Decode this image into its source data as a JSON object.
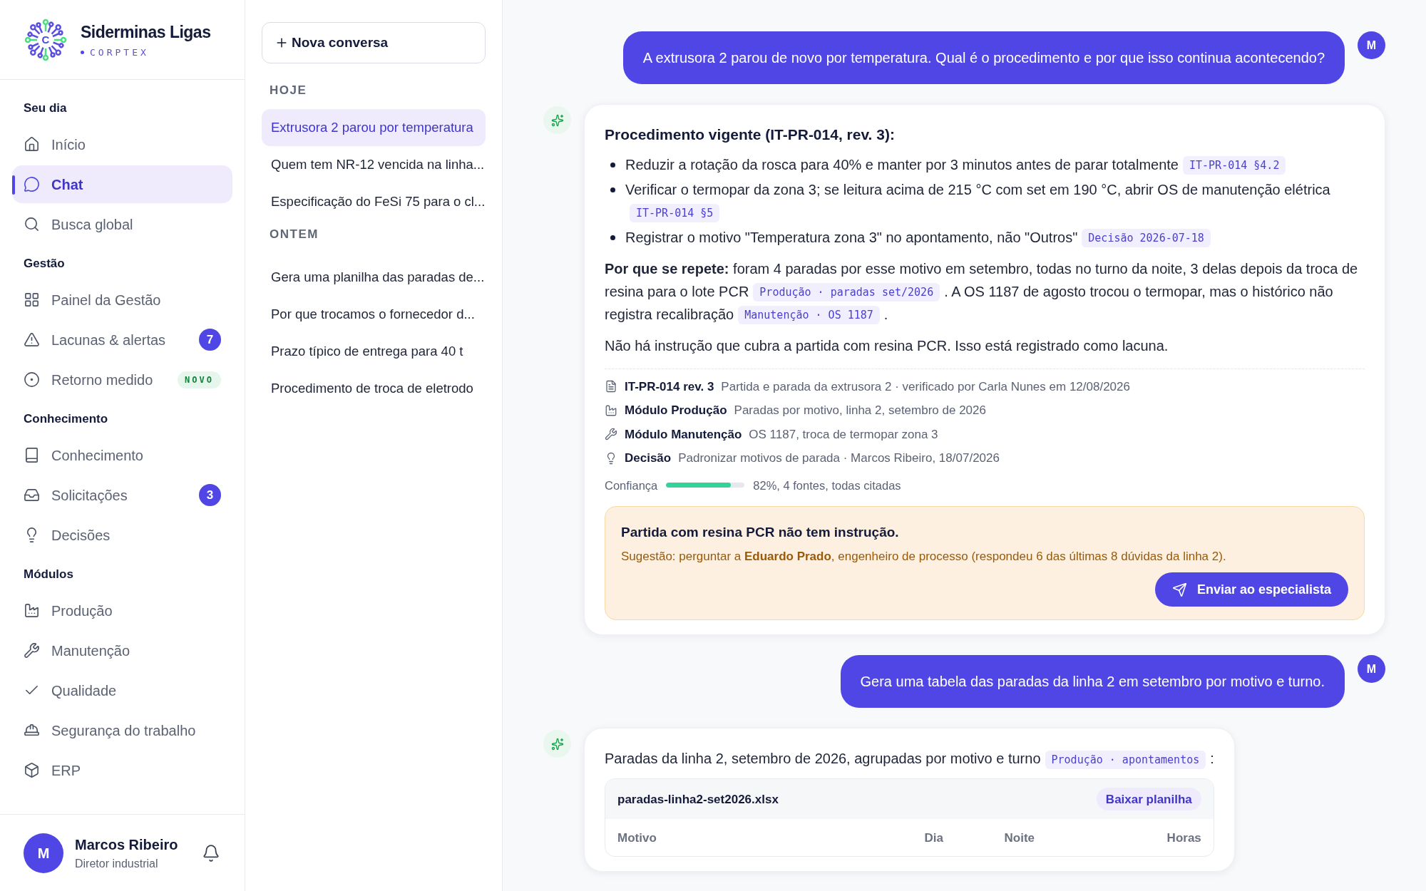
{
  "brand": {
    "name": "Siderminas Ligas",
    "product": "CORPTEX",
    "logo_letter": "C"
  },
  "sidebar": {
    "sections": [
      {
        "title": "Seu dia",
        "items": [
          {
            "label": "Início",
            "selected": false
          },
          {
            "label": "Chat",
            "selected": true
          },
          {
            "label": "Busca global",
            "selected": false
          }
        ]
      },
      {
        "title": "Gestão",
        "items": [
          {
            "label": "Painel da Gestão",
            "selected": false
          },
          {
            "label": "Lacunas & alertas",
            "selected": false,
            "badge": {
              "kind": "count",
              "text": "7"
            }
          },
          {
            "label": "Retorno medido",
            "selected": false,
            "badge": {
              "kind": "new",
              "text": "NOVO"
            }
          }
        ]
      },
      {
        "title": "Conhecimento",
        "items": [
          {
            "label": "Conhecimento",
            "selected": false
          },
          {
            "label": "Solicitações",
            "selected": false,
            "badge": {
              "kind": "count",
              "text": "3"
            }
          },
          {
            "label": "Decisões",
            "selected": false
          }
        ]
      },
      {
        "title": "Módulos",
        "items": [
          {
            "label": "Produção",
            "selected": false
          },
          {
            "label": "Manutenção",
            "selected": false
          },
          {
            "label": "Qualidade",
            "selected": false
          },
          {
            "label": "Segurança do trabalho",
            "selected": false
          },
          {
            "label": "ERP",
            "selected": false
          }
        ]
      }
    ],
    "user": {
      "initial": "M",
      "name": "Marcos Ribeiro",
      "role": "Diretor industrial"
    }
  },
  "conversations": {
    "new_button": "Nova conversa",
    "groups": [
      {
        "title": "HOJE",
        "items": [
          {
            "title": "Extrusora 2 parou por temperatura",
            "selected": true
          },
          {
            "title": "Quem tem NR-12 vencida na linha...",
            "selected": false
          },
          {
            "title": "Especificação do FeSi 75 para o cl...",
            "selected": false
          }
        ]
      },
      {
        "title": "ONTEM",
        "items": [
          {
            "title": "Gera uma planilha das paradas de...",
            "selected": false
          },
          {
            "title": "Por que trocamos o fornecedor d...",
            "selected": false
          },
          {
            "title": "Prazo típico de entrega para 40 t",
            "selected": false
          },
          {
            "title": "Procedimento de troca de eletrodo",
            "selected": false
          }
        ]
      }
    ]
  },
  "chat": {
    "messages": [
      {
        "kind": "user",
        "text": "A extrusora 2 parou de novo por temperatura. Qual é o procedimento e por que isso continua acontecendo?",
        "avatar": "M"
      },
      {
        "kind": "answer",
        "heading": "Procedimento vigente (IT-PR-014, rev. 3):",
        "bullets": [
          {
            "text": "Reduzir a rotação da rosca para 40% e manter por 3 minutos antes de parar totalmente",
            "cite": "IT-PR-014 §4.2"
          },
          {
            "text": "Verificar o termopar da zona 3; se leitura acima de 215 °C com set em 190 °C, abrir OS de manutenção elétrica",
            "cite": "IT-PR-014 §5"
          },
          {
            "text": "Registrar o motivo \"Temperatura zona 3\" no apontamento, não \"Outros\"",
            "cite": "Decisão 2026-07-18"
          }
        ],
        "paragraphs": [
          [
            {
              "kind": "text",
              "text": "**Por que se repete:** foram 4 paradas por esse motivo em setembro, todas no turno da noite, 3 delas depois da troca de resina para o lote PCR"
            },
            {
              "kind": "cite",
              "text": "Produção · paradas set/2026"
            },
            {
              "kind": "text",
              "text": ". A OS 1187 de agosto trocou o termopar, mas o histórico não registra recalibração"
            },
            {
              "kind": "cite",
              "text": "Manutenção · OS 1187"
            },
            {
              "kind": "text",
              "text": "."
            }
          ],
          [
            {
              "kind": "text",
              "text": "Não há instrução que cubra a partida com resina PCR. Isso está registrado como lacuna."
            }
          ]
        ],
        "sources": [
          {
            "title": "IT-PR-014 rev. 3",
            "detail": "Partida e parada da extrusora 2 · verificado por Carla Nunes em 12/08/2026"
          },
          {
            "title": "Módulo Produção",
            "detail": "Paradas por motivo, linha 2, setembro de 2026"
          },
          {
            "title": "Módulo Manutenção",
            "detail": "OS 1187, troca de termopar zona 3"
          },
          {
            "title": "Decisão",
            "detail": "Padronizar motivos de parada · Marcos Ribeiro, 18/07/2026"
          }
        ],
        "confidence": {
          "label": "Confiança",
          "level": 0.82,
          "reading": "82%, 4 fontes, todas citadas"
        },
        "alert": {
          "title": "Partida com resina PCR não tem instrução.",
          "text": "Sugestão: perguntar a **Eduardo Prado**, engenheiro de processo (respondeu 6 das últimas 8 dúvidas da linha 2).",
          "button": "Enviar ao especialista"
        }
      },
      {
        "kind": "user",
        "text": "Gera uma tabela das paradas da linha 2 em setembro por motivo e turno.",
        "avatar": "M"
      },
      {
        "kind": "table_answer",
        "intro": [
          {
            "kind": "text",
            "text": "Paradas da linha 2, setembro de 2026, agrupadas por motivo e turno"
          },
          {
            "kind": "cite",
            "text": "Produção · apontamentos"
          },
          {
            "kind": "text",
            "text": ":"
          }
        ],
        "file": {
          "name": "paradas-linha2-set2026.xlsx",
          "button": "Baixar planilha",
          "columns": [
            "Motivo",
            "Dia",
            "Noite",
            "Horas"
          ]
        }
      }
    ]
  }
}
